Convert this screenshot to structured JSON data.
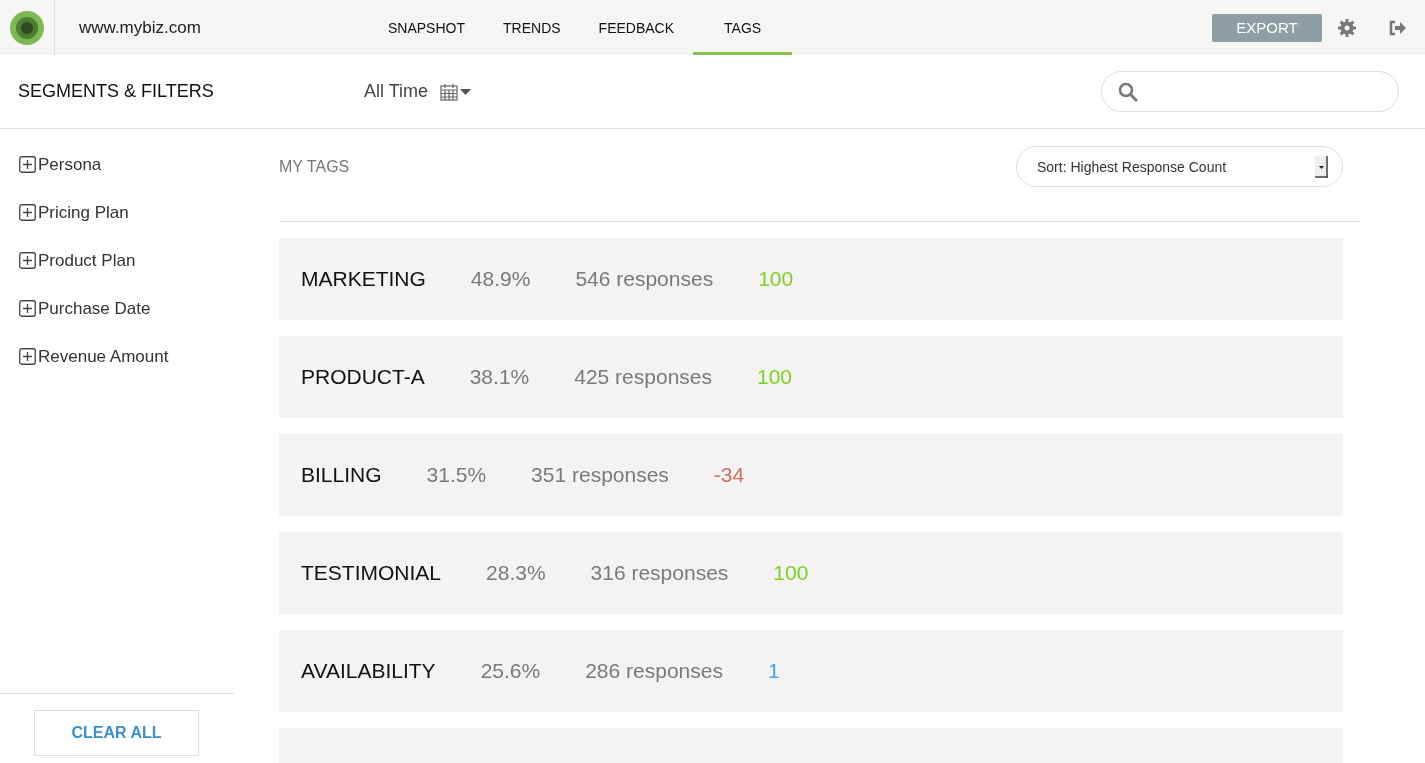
{
  "header": {
    "site": "www.mybiz.com",
    "tabs": [
      {
        "label": "SNAPSHOT",
        "selected": false
      },
      {
        "label": "TRENDS",
        "selected": false
      },
      {
        "label": "FEEDBACK",
        "selected": false
      },
      {
        "label": "TAGS",
        "selected": true
      }
    ],
    "export_button": "EXPORT"
  },
  "toolbar": {
    "title": "SEGMENTS & FILTERS",
    "date_range": "All Time"
  },
  "sidebar": {
    "items": [
      {
        "label": "Persona",
        "expanded": false
      },
      {
        "label": "Pricing Plan",
        "expanded": false
      },
      {
        "label": "Product Plan",
        "expanded": false
      },
      {
        "label": "Purchase Date",
        "expanded": false
      },
      {
        "label": "Revenue Amount",
        "expanded": false
      }
    ],
    "clear_button": "CLEAR ALL"
  },
  "tags": {
    "title": "MY TAGS",
    "sort": "Sort: Highest Response Count",
    "rows": [
      {
        "name": "MARKETING",
        "percent": "48.9%",
        "responses": "546 responses",
        "score": "100",
        "color": "#7ed321"
      },
      {
        "name": "PRODUCT-A",
        "percent": "38.1%",
        "responses": "425 responses",
        "score": "100",
        "color": "#7ed321"
      },
      {
        "name": "BILLING",
        "percent": "31.5%",
        "responses": "351 responses",
        "score": "-34",
        "color": "#d0705a"
      },
      {
        "name": "TESTIMONIAL",
        "percent": "28.3%",
        "responses": "316 responses",
        "score": "100",
        "color": "#7ed321"
      },
      {
        "name": "AVAILABILITY",
        "percent": "25.6%",
        "responses": "286 responses",
        "score": "1",
        "color": "#3fa3e0"
      }
    ],
    "partial_row_below": true
  }
}
